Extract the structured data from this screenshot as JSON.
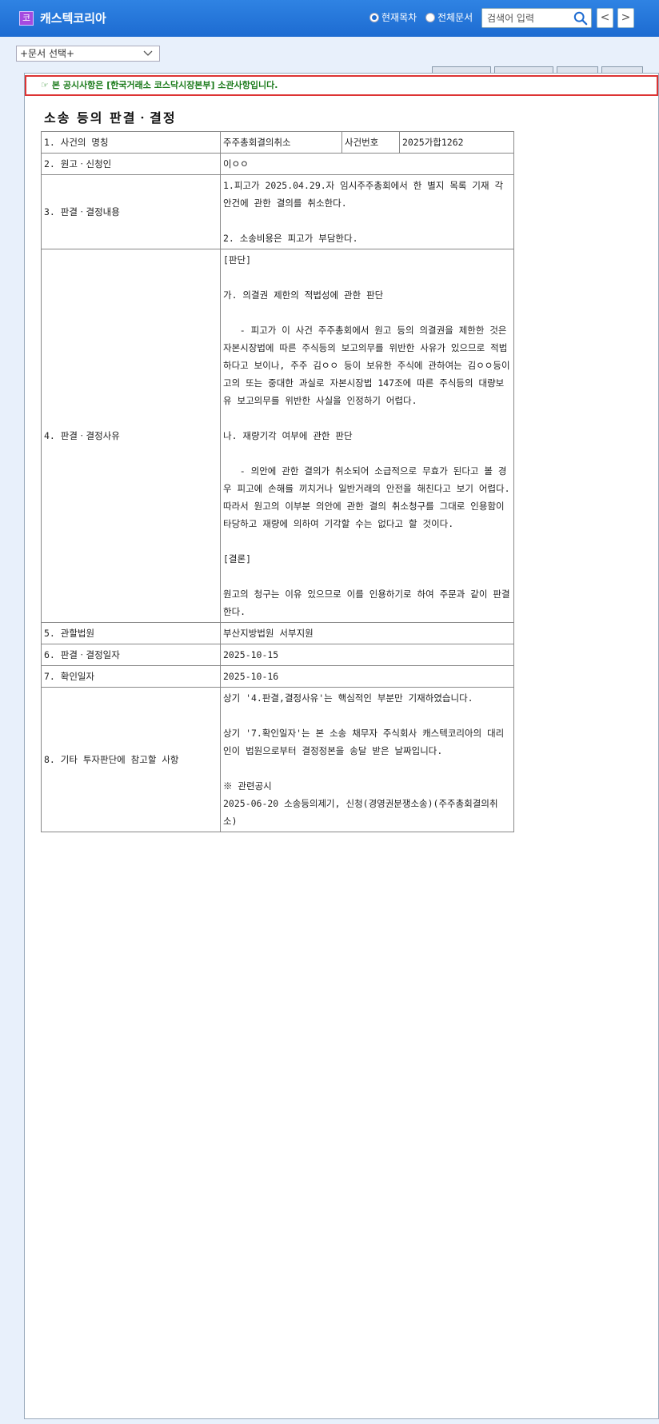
{
  "app": {
    "icon_char": "코",
    "title": "캐스텍코리아"
  },
  "search": {
    "scope_current": "현재목차",
    "scope_all": "전체문서",
    "placeholder": "검색어 입력",
    "prev_label": "<",
    "next_label": ">"
  },
  "doc_select": {
    "selected": "+문서 선택+"
  },
  "notice": {
    "text": "본 공시사항은 [한국거래소 코스닥시장본부] 소관사항입니다."
  },
  "document": {
    "title": "소송 등의 판결ㆍ결정",
    "rows": [
      {
        "label": "1. 사건의 명칭",
        "value": "주주총회결의취소",
        "sub_label": "사건번호",
        "sub_value": "2025가합1262"
      },
      {
        "label": "2. 원고ㆍ신청인",
        "value": "이ㅇㅇ"
      },
      {
        "label": "3. 판결ㆍ결정내용",
        "value": "1.피고가 2025.04.29.자 임시주주총회에서 한 별지 목록 기재 각 안건에 관한 결의를 취소한다.\n\n2. 소송비용은 피고가 부담한다."
      },
      {
        "label": "4. 판결ㆍ결정사유",
        "value": "[판단]\n\n가. 의결권 제한의 적법성에 관한 판단\n\n   - 피고가 이 사건 주주총회에서 원고 등의 의결권을 제한한 것은 자본시장법에 따른 주식등의 보고의무를 위반한 사유가 있으므로 적법하다고 보이나, 주주 김ㅇㅇ 등이 보유한 주식에 관하여는 김ㅇㅇ등이 고의 또는 중대한 과실로 자본시장법 147조에 따른 주식등의 대량보유 보고의무를 위반한 사실을 인정하기 어렵다.\n\n나. 재량기각 여부에 관한 판단\n\n   - 의안에 관한 결의가 취소되어 소급적으로 무효가 된다고 볼 경우 피고에 손해를 끼치거나 일반거래의 안전을 해친다고 보기 어렵다. 따라서 원고의 이부분 의안에 관한 결의 취소청구를 그대로 인용함이 타당하고 재량에 의하여 기각할 수는 없다고 할 것이다.\n\n[결론]\n\n원고의 청구는 이유 있으므로 이를 인용하기로 하여 주문과 같이 판결한다."
      },
      {
        "label": "5. 관할법원",
        "value": "부산지방법원 서부지원"
      },
      {
        "label": "6. 판결ㆍ결정일자",
        "value": "2025-10-15"
      },
      {
        "label": "7. 확인일자",
        "value": "2025-10-16"
      },
      {
        "label": "8. 기타 투자판단에 참고할 사항",
        "value": "상기 '4.판결,결정사유'는 핵심적인 부분만 기재하였습니다.\n\n상기 '7.확인일자'는 본 소송 채무자 주식회사 캐스텍코리아의 대리인이 법원으로부터 결정정본을 송달 받은 날짜입니다.\n\n※ 관련공시\n2025-06-20 소송등의제기, 신청(경영권분쟁소송)(주주총회결의취소)"
      }
    ]
  },
  "colors": {
    "header_bg": "#1d6bd1",
    "page_bg": "#e8f0fb",
    "notice_border": "#dd3333",
    "notice_text": "#1a7a1a"
  }
}
